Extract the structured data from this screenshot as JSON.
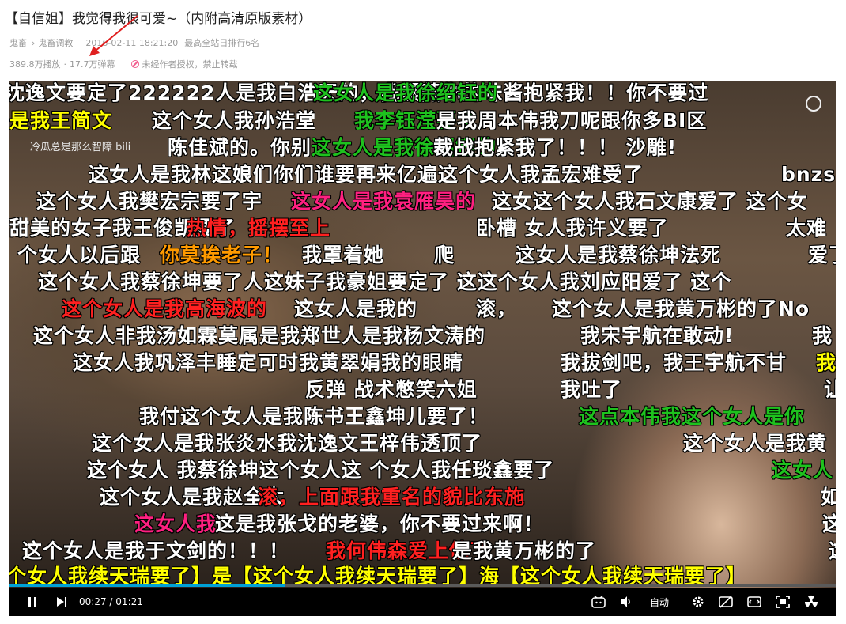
{
  "video": {
    "title": "【自信姐】我觉得我很可爱~（内附高清原版素材）",
    "breadcrumb": [
      "鬼畜",
      "鬼畜调教"
    ],
    "publish_time": "2016-02-11 18:21:20",
    "rank": "最高全站日排行6名",
    "views": "389.8万播放",
    "separator": "·",
    "danmaku_count": "17.7万弹幕",
    "copyright_notice": "未经作者授权，禁止转载"
  },
  "player": {
    "watermark": "冷瓜总是那么智障 bili",
    "current_time": "00:27",
    "time_sep": "/",
    "duration": "01:21",
    "progress": 0.333,
    "quality_label": "自动",
    "controls": [
      "danmaku-face-icon",
      "volume-icon",
      "settings-gear-icon",
      "danmaku-off-icon",
      "widescreen-icon",
      "fullscreen-icon",
      "radiation-icon"
    ]
  },
  "danmaku": [
    {
      "text": "沈逸文要定了222222人是我白浩天的，我爆蒸你的味酱抱紧我！！你不要过",
      "color": "#ffffff"
    },
    {
      "text": "这女人是我徐绍钰的",
      "color": "#1ec21e"
    },
    {
      "text": "是我王简文",
      "color": "#ffff00"
    },
    {
      "text": "这个女人我孙浩堂",
      "color": "#ffffff"
    },
    {
      "text": "我李钰滢要了",
      "color": "#1ec21e"
    },
    {
      "text": "是我周本伟我刀呢跟你多BI区",
      "color": "#ffffff"
    },
    {
      "text": "陈佳斌的。你别",
      "color": "#ffffff"
    },
    {
      "text": "这女人是我徐绍钰的",
      "color": "#1ec21e"
    },
    {
      "text": "裁战抱紧我了！！！ 沙雕!",
      "color": "#ffffff"
    },
    {
      "text": "这女人是我林这娘们你们谁要再来亿遍这个女人我孟宏难受了",
      "color": "#ffffff"
    },
    {
      "text": "bnzs",
      "color": "#ffffff"
    },
    {
      "text": "这个女人我樊宏宗要了宇",
      "color": "#ffffff"
    },
    {
      "text": "这女人是我袁雁昊的",
      "color": "#ff2080"
    },
    {
      "text": "这女这个女人我石文康爱了 这个女",
      "color": "#ffffff"
    },
    {
      "text": "甜美的女子我王俊凯要了",
      "color": "#ffffff"
    },
    {
      "text": "热情，摇摆至上",
      "color": "#ff2020"
    },
    {
      "text": "卧槽 女人我许义要了",
      "color": "#ffffff"
    },
    {
      "text": "太难",
      "color": "#ffffff"
    },
    {
      "text": "个女人以后跟",
      "color": "#ffffff"
    },
    {
      "text": "你莫挨老子！",
      "color": "#ff9a00"
    },
    {
      "text": "我罩着她",
      "color": "#ffffff"
    },
    {
      "text": "爬",
      "color": "#ffffff"
    },
    {
      "text": "这女人是我蔡徐坤法死",
      "color": "#ffffff"
    },
    {
      "text": "爱了",
      "color": "#ffffff"
    },
    {
      "text": "这个女人我蔡徐坤要了人这妹子我豪姐要定了 这这个女人我刘应阳爱了 这个",
      "color": "#ffffff"
    },
    {
      "text": "这个女人是我高海波的",
      "color": "#ff2020"
    },
    {
      "text": "这女人是我的",
      "color": "#ffffff"
    },
    {
      "text": "滚，",
      "color": "#ffffff"
    },
    {
      "text": "这个女人是我黄万彬的了No",
      "color": "#ffffff"
    },
    {
      "text": "这个女人非我汤如霖莫属是我郑世人是我杨文涛的",
      "color": "#ffffff"
    },
    {
      "text": "我宋宇航在敢动!",
      "color": "#ffffff"
    },
    {
      "text": "我",
      "color": "#ffffff"
    },
    {
      "text": "这女人我巩泽丰睡定可时我黄翠娟我的眼睛",
      "color": "#ffffff"
    },
    {
      "text": "我拔剑吧，我王宇航不甘",
      "color": "#ffffff"
    },
    {
      "text": "我",
      "color": "#ffff00"
    },
    {
      "text": "反弹 战术憋笑六姐",
      "color": "#ffffff"
    },
    {
      "text": "我吐了",
      "color": "#ffffff"
    },
    {
      "text": "让",
      "color": "#ffffff"
    },
    {
      "text": "我付这个女人是我陈书王鑫坤儿要了！",
      "color": "#ffffff"
    },
    {
      "text": "这点本伟我这个女人是你",
      "color": "#1ec21e"
    },
    {
      "text": "这个女人是我张炎水我沈逸文王梓伟透顶了",
      "color": "#ffffff"
    },
    {
      "text": "这个女人是我黄",
      "color": "#ffffff"
    },
    {
      "text": "这个女人 我蔡徐坤这个女人这 个女人我任琰鑫要了",
      "color": "#ffffff"
    },
    {
      "text": "这女人",
      "color": "#1ec21e"
    },
    {
      "text": "这个女人是我赵全太",
      "color": "#ffffff"
    },
    {
      "text": "滚，上面跟我重名的貌比东施",
      "color": "#ff2020"
    },
    {
      "text": "如",
      "color": "#ffffff"
    },
    {
      "text": "这女人我",
      "color": "#ff2080"
    },
    {
      "text": "这是我张戈的老婆，你不要过来啊！",
      "color": "#ffffff"
    },
    {
      "text": "这",
      "color": "#ffffff"
    },
    {
      "text": "这个女人是我于文剑的！！！",
      "color": "#ffffff"
    },
    {
      "text": "我何伟森爱上他了",
      "color": "#ff2020"
    },
    {
      "text": "是我黄万彬的了",
      "color": "#ffffff"
    },
    {
      "text": "这",
      "color": "#ffffff"
    },
    {
      "text": "个女人我续天瑞要了】是【这个女人我续天瑞要了】海【这个女人我续天瑞要了】",
      "color": "#ffff00"
    }
  ]
}
